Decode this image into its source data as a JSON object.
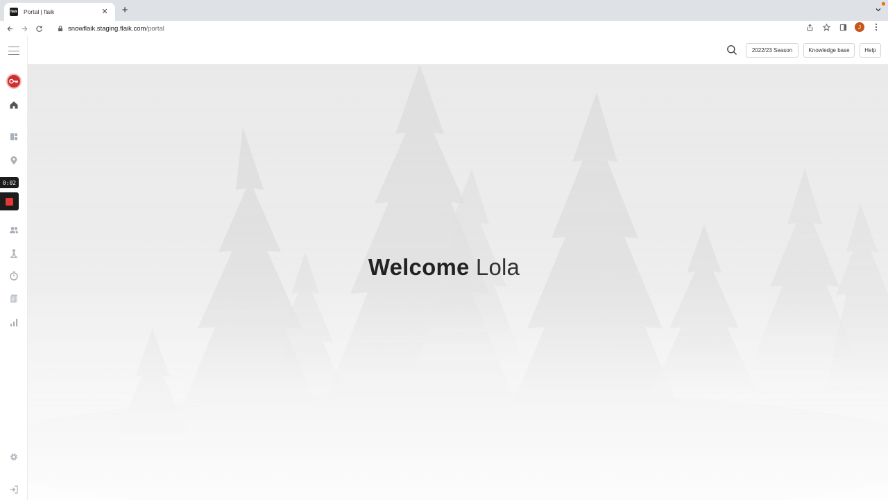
{
  "browser": {
    "tab_title": "Portal | flaik",
    "favicon_text": "flaik",
    "url_host": "snowflaik.staging.flaik.com",
    "url_path": "/portal",
    "profile_initial": "J"
  },
  "sidebar": {
    "recording_time": "0:02"
  },
  "header": {
    "season_label": "2022/23 Season",
    "knowledge_base_label": "Knowledge base",
    "help_label": "Help"
  },
  "hero": {
    "welcome_word": "Welcome",
    "user_name": "Lola"
  },
  "colors": {
    "brand_red": "#cf2e2e",
    "record_red": "#e53935",
    "profile_orange": "#c6561b"
  }
}
